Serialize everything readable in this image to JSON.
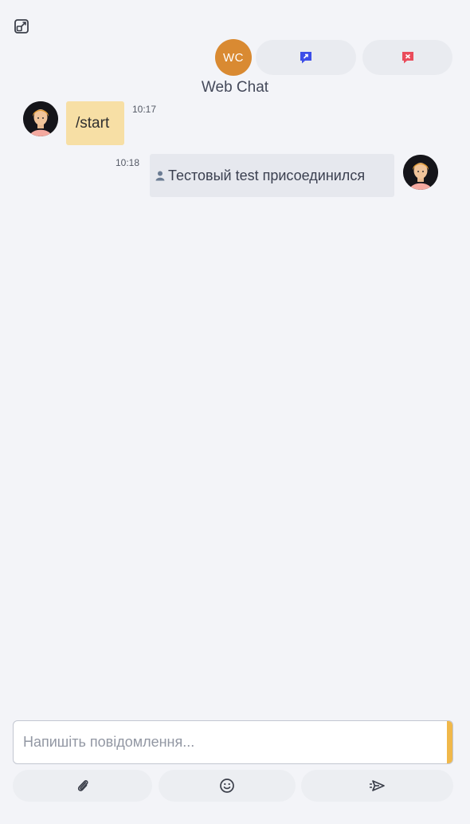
{
  "header": {
    "expand_icon": "expand-icon",
    "avatar_initials": "WC",
    "avatar_color": "#d98a32",
    "transfer_icon": "transfer-icon",
    "transfer_color": "#3d4ee8",
    "close_icon": "close-chat-icon",
    "close_color": "#ea4c5b",
    "title": "Web Chat"
  },
  "messages": [
    {
      "sender": "user",
      "text": "/start",
      "time": "10:17",
      "color": "#f7dfa5"
    },
    {
      "sender": "operator",
      "text": "Тестовый test присоединился",
      "time": "10:18",
      "icon": "person-icon",
      "color": "#e6e8ee"
    }
  ],
  "composer": {
    "placeholder": "Напишіть повідомлення...",
    "value": "",
    "accent": "#f0b84a",
    "attach_icon": "paperclip-icon",
    "emoji_icon": "smiley-icon",
    "send_icon": "send-icon"
  }
}
